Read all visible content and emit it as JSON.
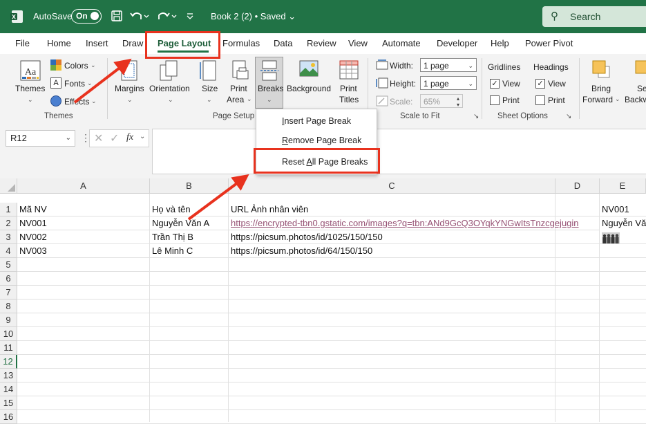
{
  "titlebar": {
    "autosave_label": "AutoSave",
    "autosave_state": "On",
    "doc_title": "Book 2 (2) • Saved ⌄",
    "search_placeholder": "Search"
  },
  "tabs": [
    "File",
    "Home",
    "Insert",
    "Draw",
    "Page Layout",
    "Formulas",
    "Data",
    "Review",
    "View",
    "Automate",
    "Developer",
    "Help",
    "Power Pivot"
  ],
  "active_tab": "Page Layout",
  "ribbon": {
    "themes": {
      "themes_label": "Themes",
      "colors_label": "Colors",
      "fonts_label": "Fonts",
      "effects_label": "Effects",
      "group": "Themes"
    },
    "page_setup": {
      "margins": "Margins",
      "orientation": "Orientation",
      "size": "Size",
      "print_area_1": "Print",
      "print_area_2": "Area",
      "breaks": "Breaks",
      "background": "Background",
      "print_titles_1": "Print",
      "print_titles_2": "Titles",
      "group": "Page Setup"
    },
    "scale_to_fit": {
      "width_label": "Width:",
      "width_value": "1 page",
      "height_label": "Height:",
      "height_value": "1 page",
      "scale_label": "Scale:",
      "scale_value": "65%",
      "group": "Scale to Fit"
    },
    "sheet_options": {
      "gridlines": "Gridlines",
      "headings": "Headings",
      "view": "View",
      "print": "Print",
      "group": "Sheet Options"
    },
    "arrange": {
      "bring_forward_1": "Bring",
      "bring_forward_2": "Forward",
      "send_backward_1": "Se",
      "send_backward_2": "Backw"
    }
  },
  "breaks_menu": [
    {
      "pre": "",
      "key": "I",
      "post": "nsert Page Break"
    },
    {
      "pre": "",
      "key": "R",
      "post": "emove Page Break"
    },
    {
      "pre": "Reset ",
      "key": "A",
      "post": "ll Page Breaks"
    }
  ],
  "formula_bar": {
    "name_box": "R12",
    "fx": "fx"
  },
  "columns": [
    "A",
    "B",
    "C",
    "D",
    "E"
  ],
  "rows": [
    "1",
    "2",
    "3",
    "4",
    "5",
    "6",
    "7",
    "8",
    "9",
    "10",
    "11",
    "12",
    "13",
    "14",
    "15",
    "16"
  ],
  "selected_row": "12",
  "cells": {
    "a1": "Mã NV",
    "b1": "Họ và tên",
    "c1": "URL Ảnh nhân viên",
    "e1": "NV001",
    "a2": "NV001",
    "b2": "Nguyễn Văn A",
    "c2": "https://encrypted-tbn0.gstatic.com/images?q=tbn:ANd9GcQ3OYqkYNGwItsTnzcgejugin",
    "e2": "Nguyễn Văn",
    "a3": "NV002",
    "b3": "Trần Thị B",
    "c3": "https://picsum.photos/id/1025/150/150",
    "a4": "NV003",
    "b4": "Lê Minh C",
    "c4": "https://picsum.photos/id/64/150/150"
  },
  "colors": {
    "excel_green": "#217346",
    "annotation_red": "#e8321e",
    "link": "#954f72"
  }
}
